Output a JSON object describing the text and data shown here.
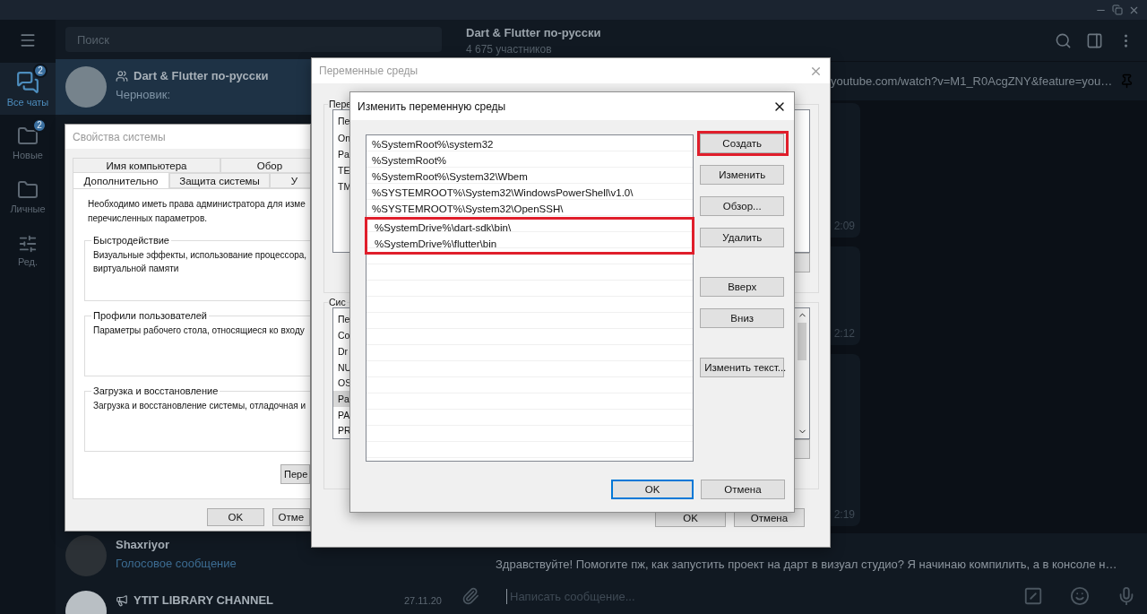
{
  "rail": {
    "folders": [
      {
        "label": "Все чаты",
        "badge": "2",
        "kind": "chats",
        "selected": true
      },
      {
        "label": "Новые",
        "badge": "2",
        "kind": "folder",
        "selected": false
      },
      {
        "label": "Личные",
        "kind": "folder",
        "selected": false
      },
      {
        "label": "Ред.",
        "kind": "edit",
        "selected": false
      }
    ]
  },
  "search": {
    "placeholder": "Поиск"
  },
  "chats": [
    {
      "name": "Dart & Flutter по-русски",
      "kind": "group",
      "preview": "Черновик:",
      "selected": true
    },
    {
      "name": "Shaxriyor",
      "kind": "user",
      "preview": "Голосовое сообщение",
      "selected": false
    },
    {
      "name": "YTIT LIBRARY CHANNEL",
      "kind": "channel",
      "date": "27.11.20",
      "selected": false
    }
  ],
  "chat": {
    "title": "Dart & Flutter по-русски",
    "subtitle": "4 675 участников",
    "pinned": "youtube.com/watch?v=M1_R0AcgZNY&feature=you…",
    "messages": [
      {
        "time": "2:09"
      },
      {
        "time": "2:12"
      },
      {
        "time": "2:19"
      }
    ],
    "reply": "Здравствуйте! Помогите пж, как запустить проект на дарт в визуал студио? Я начинаю компилить, а в консоле н…",
    "input": {
      "placeholder": "Написать сообщение..."
    }
  },
  "system_properties": {
    "title": "Свойства системы",
    "tab_rows": [
      {
        "tabs": [
          {
            "label": "Имя компьютера",
            "selected": false
          },
          {
            "label": "Обор",
            "selected": false
          }
        ]
      },
      {
        "tabs": [
          {
            "label": "Дополнительно",
            "selected": true
          },
          {
            "label": "Защита системы",
            "selected": false
          },
          {
            "label": "У",
            "selected": false
          }
        ]
      }
    ],
    "notice": "Необходимо иметь права администратора для изме\nперечисленных параметров.",
    "groups": [
      {
        "title": "Быстродействие",
        "text": "Визуальные эффекты, использование процессора,\nвиртуальной памяти"
      },
      {
        "title": "Профили пользователей",
        "text": "Параметры рабочего стола, относящиеся ко входу"
      },
      {
        "title": "Загрузка и восстановление",
        "text": "Загрузка и восстановление системы, отладочная и"
      }
    ],
    "panel_button": "Пере",
    "buttons": [
      "OK",
      "Отме"
    ]
  },
  "environment_variables": {
    "title": "Переменные среды",
    "user_group": {
      "title": "Пере",
      "header": "Пе",
      "rows": [
        {
          "text": "On",
          "selected": false
        },
        {
          "text": "Pa",
          "selected": false
        },
        {
          "text": "TE",
          "selected": false
        },
        {
          "text": "TM",
          "selected": false
        }
      ]
    },
    "system_group": {
      "title": "Сис",
      "header": "Пе",
      "rows": [
        {
          "text": "Co",
          "selected": false
        },
        {
          "text": "Dr",
          "selected": false
        },
        {
          "text": "NU",
          "selected": false
        },
        {
          "text": "OS",
          "selected": false
        },
        {
          "text": "Pa",
          "selected": true
        },
        {
          "text": "PA",
          "selected": false
        },
        {
          "text": "PR",
          "selected": false
        }
      ]
    },
    "buttons": [
      "OK",
      "Отмена"
    ]
  },
  "edit_variable": {
    "title": "Изменить переменную среды",
    "paths": [
      {
        "text": "%SystemRoot%\\system32",
        "marked": false
      },
      {
        "text": "%SystemRoot%",
        "marked": false
      },
      {
        "text": "%SystemRoot%\\System32\\Wbem",
        "marked": false
      },
      {
        "text": "%SYSTEMROOT%\\System32\\WindowsPowerShell\\v1.0\\",
        "marked": false
      },
      {
        "text": "%SYSTEMROOT%\\System32\\OpenSSH\\",
        "marked": false
      },
      {
        "text": "%SystemDrive%\\dart-sdk\\bin\\",
        "marked": true
      },
      {
        "text": "%SystemDrive%\\flutter\\bin",
        "marked": true
      }
    ],
    "button_groups": [
      [
        {
          "label": "Создать",
          "marked": true
        },
        {
          "label": "Изменить",
          "marked": false
        },
        {
          "label": "Обзор...",
          "marked": false
        },
        {
          "label": "Удалить",
          "marked": false
        }
      ],
      [
        {
          "label": "Вверх",
          "marked": false
        },
        {
          "label": "Вниз",
          "marked": false
        }
      ],
      [
        {
          "label": "Изменить текст...",
          "marked": false
        }
      ]
    ],
    "ok": "OK",
    "cancel": "Отмена"
  }
}
